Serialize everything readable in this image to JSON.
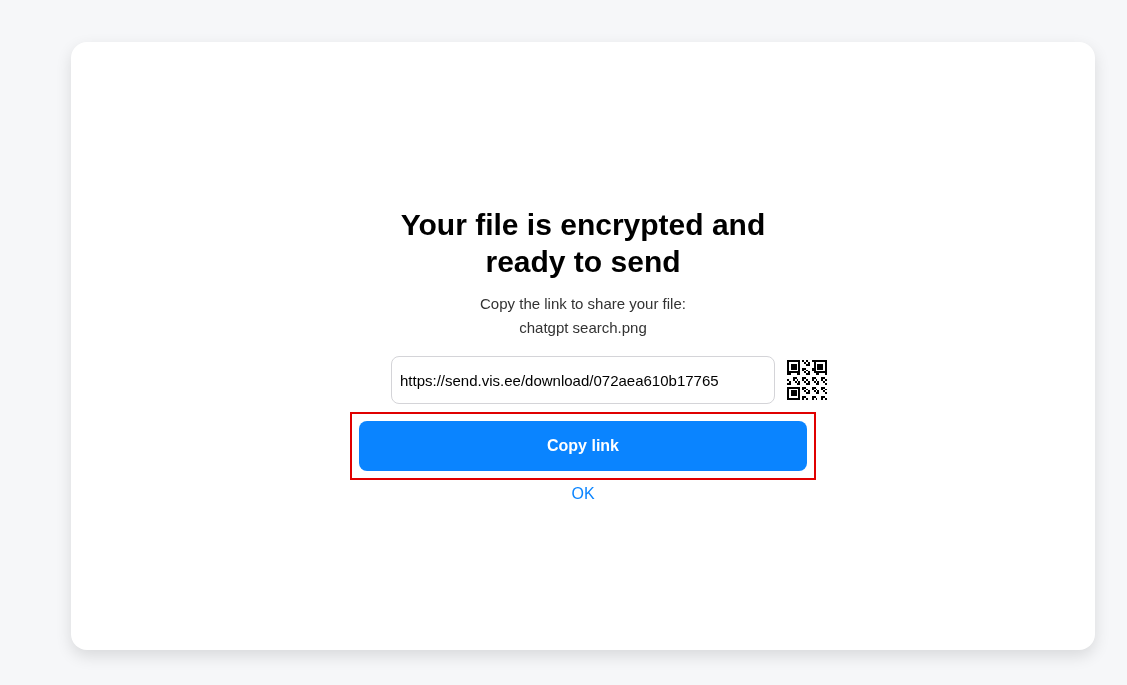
{
  "dialog": {
    "title": "Your file is encrypted and ready to send",
    "instruction": "Copy the link to share your file:",
    "file_name": "chatgpt search.png",
    "link_field": {
      "value": "https://send.vis.ee/download/072aea610b17765"
    },
    "copy_button": {
      "label": "Copy link",
      "highlighted": true
    },
    "ok_link": "OK"
  }
}
